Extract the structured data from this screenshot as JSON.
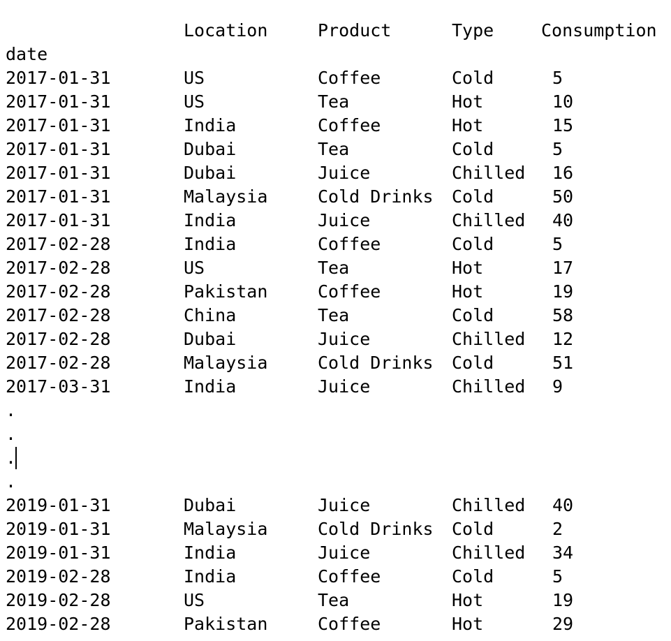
{
  "header": {
    "columns": [
      "Location",
      "Product",
      "Type",
      "Consumption"
    ],
    "index_name": "date"
  },
  "rows_top": [
    {
      "date": "2017-01-31",
      "location": "US",
      "product": "Coffee",
      "type": "Cold",
      "consumption": "5"
    },
    {
      "date": "2017-01-31",
      "location": "US",
      "product": "Tea",
      "type": "Hot",
      "consumption": "10"
    },
    {
      "date": "2017-01-31",
      "location": "India",
      "product": "Coffee",
      "type": "Hot",
      "consumption": "15"
    },
    {
      "date": "2017-01-31",
      "location": "Dubai",
      "product": "Tea",
      "type": "Cold",
      "consumption": "5"
    },
    {
      "date": "2017-01-31",
      "location": "Dubai",
      "product": "Juice",
      "type": "Chilled",
      "consumption": "16"
    },
    {
      "date": "2017-01-31",
      "location": "Malaysia",
      "product": "Cold Drinks",
      "type": "Cold",
      "consumption": "50"
    },
    {
      "date": "2017-01-31",
      "location": "India",
      "product": "Juice",
      "type": "Chilled",
      "consumption": "40"
    },
    {
      "date": "2017-02-28",
      "location": "India",
      "product": "Coffee",
      "type": "Cold",
      "consumption": "5"
    },
    {
      "date": "2017-02-28",
      "location": "US",
      "product": "Tea",
      "type": "Hot",
      "consumption": "17"
    },
    {
      "date": "2017-02-28",
      "location": "Pakistan",
      "product": "Coffee",
      "type": "Hot",
      "consumption": "19"
    },
    {
      "date": "2017-02-28",
      "location": "China",
      "product": "Tea",
      "type": "Cold",
      "consumption": "58"
    },
    {
      "date": "2017-02-28",
      "location": "Dubai",
      "product": "Juice",
      "type": "Chilled",
      "consumption": "12"
    },
    {
      "date": "2017-02-28",
      "location": "Malaysia",
      "product": "Cold Drinks",
      "type": "Cold",
      "consumption": "51"
    },
    {
      "date": "2017-03-31",
      "location": "India",
      "product": "Juice",
      "type": "Chilled",
      "consumption": "9"
    }
  ],
  "ellipsis": [
    ".",
    ".",
    ".",
    "."
  ],
  "rows_bottom": [
    {
      "date": "2019-01-31",
      "location": "Dubai",
      "product": "Juice",
      "type": "Chilled",
      "consumption": "40"
    },
    {
      "date": "2019-01-31",
      "location": "Malaysia",
      "product": "Cold Drinks",
      "type": "Cold",
      "consumption": "2"
    },
    {
      "date": "2019-01-31",
      "location": "India",
      "product": "Juice",
      "type": "Chilled",
      "consumption": "34"
    },
    {
      "date": "2019-02-28",
      "location": "India",
      "product": "Coffee",
      "type": "Cold",
      "consumption": "5"
    },
    {
      "date": "2019-02-28",
      "location": "US",
      "product": "Tea",
      "type": "Hot",
      "consumption": "19"
    },
    {
      "date": "2019-02-28",
      "location": "Pakistan",
      "product": "Coffee",
      "type": "Hot",
      "consumption": "29"
    }
  ]
}
